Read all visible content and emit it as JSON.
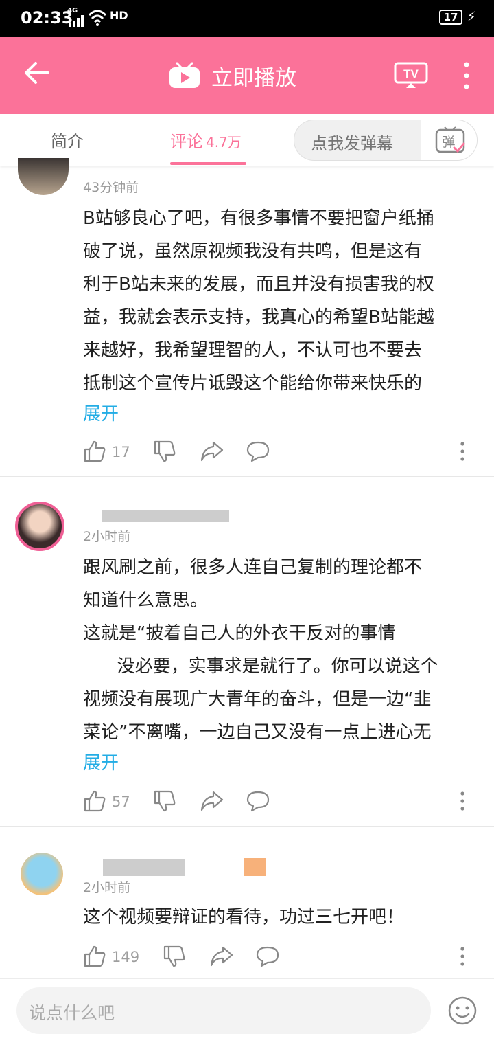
{
  "status_bar": {
    "time": "02:33",
    "network": "4G",
    "hd": "HD",
    "battery": "17"
  },
  "app_bar": {
    "title": "立即播放"
  },
  "tabs": [
    {
      "label": "简介"
    },
    {
      "label": "评论",
      "count": "4.7万"
    }
  ],
  "danmaku": {
    "placeholder": "点我发弹幕",
    "button_icon": "弹"
  },
  "comments": [
    {
      "time": "43分钟前",
      "lines": [
        "B站够良心了吧，有很多事情不要把窗户纸捅",
        "破了说，虽然原视频我没有共鸣，但是这有",
        "利于B站未来的发展，而且并没有损害我的权",
        "益，我就会表示支持，我真心的希望B站能越",
        "来越好，我希望理智的人，不认可也不要去",
        "抵制这个宣传片诋毁这个能给你带来快乐的"
      ],
      "expand": "展开",
      "likes": "17"
    },
    {
      "time": "2小时前",
      "lines": [
        "跟风刷之前，很多人连自己复制的理论都不",
        "知道什么意思。",
        "这就是“披着自己人的外衣干反对的事情",
        "      没必要，实事求是就行了。你可以说这个",
        "视频没有展现广大青年的奋斗，但是一边“韭",
        "菜论”不离嘴，一边自己又没有一点上进心无"
      ],
      "expand": "展开",
      "likes": "57"
    },
    {
      "time": "2小时前",
      "lines": [
        "这个视频要辩证的看待，功过三七开吧！"
      ],
      "likes": "149"
    }
  ],
  "input": {
    "placeholder": "说点什么吧"
  },
  "icons": {
    "back": "back-arrow-icon",
    "play": "play-icon",
    "tv": "tv-cast-icon",
    "more": "more-vertical-icon",
    "like": "thumbs-up-icon",
    "dislike": "thumbs-down-icon",
    "share": "share-icon",
    "reply": "comment-bubble-icon",
    "emoji": "emoji-icon"
  },
  "colors": {
    "brand": "#fb7299",
    "link": "#23ade5",
    "text": "#212121",
    "meta": "#999999"
  }
}
